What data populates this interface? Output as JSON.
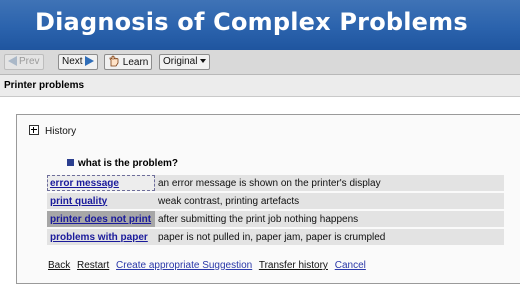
{
  "banner": {
    "title": "Diagnosis of Complex Problems"
  },
  "toolbar": {
    "prev_label": "Prev",
    "next_label": "Next",
    "learn_label": "Learn",
    "view_select": {
      "selected": "Original"
    }
  },
  "section": {
    "title": "Printer problems"
  },
  "history": {
    "label": "History"
  },
  "question": {
    "text": "what is the problem?"
  },
  "options": [
    {
      "label": "error message",
      "description": "an error message is shown on the printer's display"
    },
    {
      "label": "print quality",
      "description": "weak contrast, printing artefacts"
    },
    {
      "label": "printer does not print",
      "description": "after submitting the print job nothing happens"
    },
    {
      "label": "problems with paper",
      "description": "paper is not pulled in, paper jam, paper is crumpled"
    }
  ],
  "actions": {
    "back": "Back",
    "restart": "Restart",
    "create_suggestion": "Create appropriate Suggestion",
    "transfer_history": "Transfer history",
    "cancel": "Cancel"
  },
  "colors": {
    "banner": "#2b63ad",
    "toolbar": "#d9d9d9",
    "link": "#1a1a9b"
  }
}
